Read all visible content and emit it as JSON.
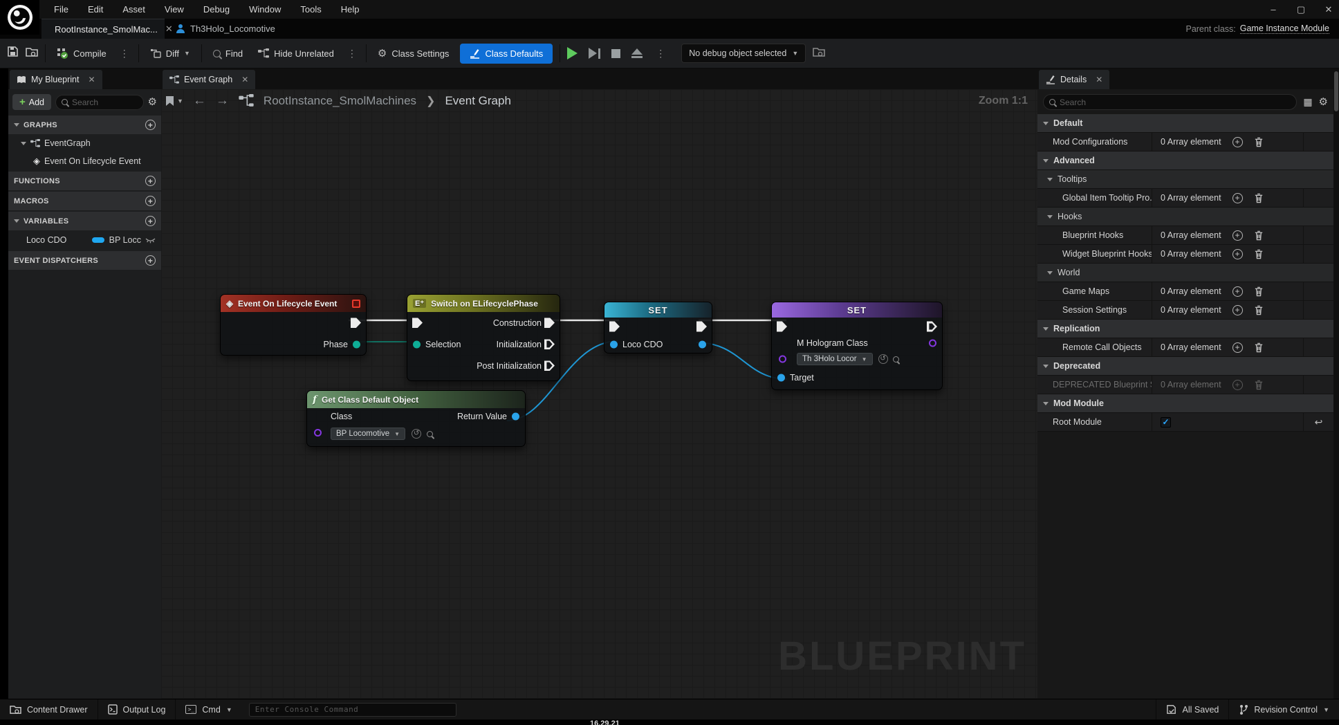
{
  "window": {
    "menu": [
      "File",
      "Edit",
      "Asset",
      "View",
      "Debug",
      "Window",
      "Tools",
      "Help"
    ],
    "tabs": [
      {
        "label": "RootInstance_SmolMac...",
        "active": true
      },
      {
        "label": "Th3Holo_Locomotive",
        "active": false
      }
    ],
    "parent_class_label": "Parent class:",
    "parent_class_value": "Game Instance Module"
  },
  "toolbar": {
    "compile": "Compile",
    "diff": "Diff",
    "find": "Find",
    "hide_unrelated": "Hide Unrelated",
    "class_settings": "Class Settings",
    "class_defaults": "Class Defaults",
    "debug_object": "No debug object selected"
  },
  "my_blueprint": {
    "title": "My Blueprint",
    "add_label": "Add",
    "search_placeholder": "Search",
    "graphs_header": "GRAPHS",
    "event_graph": "EventGraph",
    "lifecycle_event": "Event On Lifecycle Event",
    "functions_header": "FUNCTIONS",
    "macros_header": "MACROS",
    "variables_header": "VARIABLES",
    "variable_name": "Loco CDO",
    "variable_type": "BP Locc",
    "event_dispatchers_header": "EVENT DISPATCHERS"
  },
  "graph": {
    "tab": "Event Graph",
    "breadcrumb_root": "RootInstance_SmolMachines",
    "breadcrumb_current": "Event Graph",
    "zoom": "Zoom 1:1",
    "watermark": "BLUEPRINT",
    "nodes": {
      "event": {
        "title": "Event On Lifecycle Event",
        "phase": "Phase"
      },
      "switch": {
        "title": "Switch on ELifecyclePhase",
        "selection": "Selection",
        "outputs": [
          "Construction",
          "Initialization",
          "Post Initialization"
        ]
      },
      "set_loco": {
        "title": "SET",
        "pin": "Loco CDO"
      },
      "set_hologram": {
        "title": "SET",
        "pin": "M Hologram Class",
        "value": "Th 3Holo Locor",
        "target": "Target"
      },
      "get_cdo": {
        "title": "Get Class Default Object",
        "class_label": "Class",
        "class_value": "BP Locomotive",
        "return_label": "Return Value"
      }
    }
  },
  "details": {
    "title": "Details",
    "search_placeholder": "Search",
    "rows": [
      {
        "type": "header",
        "label": "Default"
      },
      {
        "type": "property",
        "label": "Mod Configurations",
        "value": "0 Array element"
      },
      {
        "type": "header",
        "label": "Advanced"
      },
      {
        "type": "subheader",
        "label": "Tooltips"
      },
      {
        "type": "property",
        "label": "Global Item Tooltip Pro...",
        "value": "0 Array element"
      },
      {
        "type": "subheader",
        "label": "Hooks"
      },
      {
        "type": "property",
        "label": "Blueprint Hooks",
        "value": "0 Array element"
      },
      {
        "type": "property",
        "label": "Widget Blueprint Hooks",
        "value": "0 Array element"
      },
      {
        "type": "subheader",
        "label": "World"
      },
      {
        "type": "property",
        "label": "Game Maps",
        "value": "0 Array element"
      },
      {
        "type": "property",
        "label": "Session Settings",
        "value": "0 Array element"
      },
      {
        "type": "header",
        "label": "Replication"
      },
      {
        "type": "property",
        "label": "Remote Call Objects",
        "value": "0 Array element"
      },
      {
        "type": "header",
        "label": "Deprecated"
      },
      {
        "type": "property",
        "label": "DEPRECATED Blueprint SC...",
        "value": "0 Array element",
        "disabled": true
      },
      {
        "type": "header",
        "label": "Mod Module"
      },
      {
        "type": "checkbox",
        "label": "Root Module",
        "checked": true
      }
    ]
  },
  "statusbar": {
    "content_drawer": "Content Drawer",
    "output_log": "Output Log",
    "cmd": "Cmd",
    "console_placeholder": "Enter Console Command",
    "all_saved": "All Saved",
    "revision_control": "Revision Control"
  },
  "overlay_timestamp": "16.29.21",
  "colors": {
    "accent_blue": "#0f6fd7",
    "compile_green": "#6bc04a",
    "play_green": "#5ecb5e",
    "node_event_red": "#a33225",
    "node_switch_olive": "#9aa233",
    "node_set_teal": "#3ab4d4",
    "node_set_purple": "#9a68e0",
    "node_function_green": "#6c956e",
    "pin_exec_white": "#ececec",
    "pin_enum_teal": "#0fae97",
    "pin_object_blue": "#2aa3ea",
    "pin_class_purple": "#8437e0",
    "variable_pill_blue": "#1fa7f0",
    "checkbox_blue": "#2ba8ff"
  }
}
